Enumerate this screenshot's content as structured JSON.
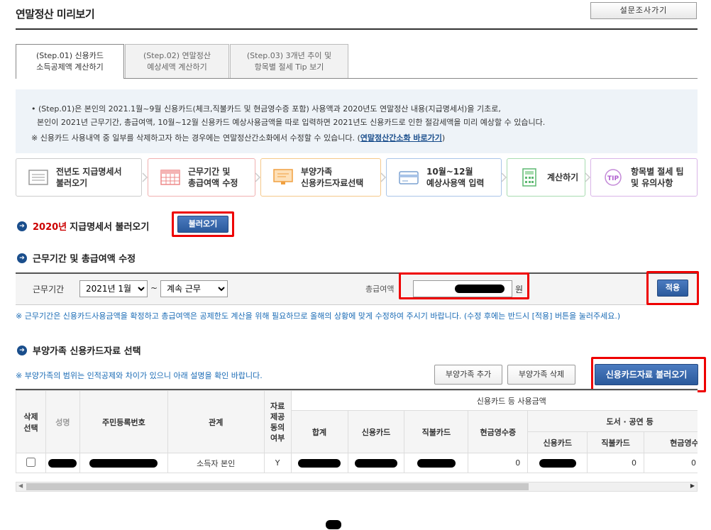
{
  "page": {
    "title": "연말정산 미리보기",
    "survey_button": "설문조사가기"
  },
  "tabs": [
    {
      "line1": "(Step.01) 신용카드",
      "line2": "소득공제액 계산하기",
      "active": true
    },
    {
      "line1": "(Step.02) 연말정산",
      "line2": "예상세액 계산하기",
      "active": false
    },
    {
      "line1": "(Step.03) 3개년 추이 및",
      "line2": "항목별 절세 Tip 보기",
      "active": false
    }
  ],
  "notice": {
    "line1": "• (Step.01)은 본인의 2021.1월~9월 신용카드(체크,직불카드 및 현금영수증 포함) 사용액과 2020년도 연말정산 내용(지급명세서)을 기초로,",
    "line2": "본인이 2021년 근무기간, 총급여액, 10월~12월 신용카드 예상사용금액을 따로 입력하면 2021년도 신용카드로 인한 절감세액을 미리 예상할 수 있습니다.",
    "line3_prefix": "※ 신용카드 사용내역 중 일부를 삭제하고자 하는 경우에는 연말정산간소화에서 수정할 수 있습니다. (",
    "line3_link": "연말정산간소화 바로가기",
    "line3_suffix": ")"
  },
  "steps": [
    {
      "line1": "전년도 지급명세서",
      "line2": "불러오기",
      "icon": "document-icon",
      "border": "#cccccc"
    },
    {
      "line1": "근무기간 및",
      "line2": "총급여액 수정",
      "icon": "calendar-icon",
      "border": "#f0b0b0"
    },
    {
      "line1": "부양가족",
      "line2": "신용카드자료선택",
      "icon": "monitor-icon",
      "border": "#f5c88a"
    },
    {
      "line1": "10월~12월",
      "line2": "예상사용액 입력",
      "icon": "card-icon",
      "border": "#a9c4e8"
    },
    {
      "line1": "계산하기",
      "line2": "",
      "icon": "calculator-icon",
      "border": "#a8dcb0"
    },
    {
      "line1": "항목별 절세 팁",
      "line2": "및 유의사항",
      "icon": "tip-icon",
      "border": "#d9b5e8"
    }
  ],
  "section1": {
    "year": "2020년",
    "title": "지급명세서 불러오기",
    "button": "불러오기"
  },
  "section2": {
    "title": "근무기간 및 총급여액 수정",
    "period_label": "근무기간",
    "start_value": "2021년 1월",
    "separator": "~",
    "end_value": "계속 근무",
    "salary_label": "총급여액",
    "currency": "원",
    "apply_button": "적용",
    "note": "※ 근무기간은 신용카드사용금액을 확정하고 총급여액은 공제한도 계산을 위해 필요하므로 올해의 상황에 맞게 수정하여 주시기 바랍니다. (수정 후에는 반드시 [적용] 버튼을 눌러주세요.)"
  },
  "section3": {
    "title": "부양가족 신용카드자료 선택",
    "note": "※ 부양가족의 범위는 인적공제와 차이가 있으니 아래 설명을 확인 바랍니다.",
    "add_button": "부양가족 추가",
    "delete_button": "부양가족 삭제",
    "load_button": "신용카드자료 불러오기"
  },
  "table": {
    "h_delete": "삭제\n선택",
    "h_name": "성명",
    "h_id": "주민등록번호",
    "h_relation": "관계",
    "h_consent": "자료\n제공\n동의\n여부",
    "h_group": "신용카드 등 사용금액",
    "h_total": "합계",
    "h_credit": "신용카드",
    "h_debit": "직불카드",
    "h_cash": "현금영수증",
    "h_culture": "도서 · 공연 등",
    "h_c_credit": "신용카드",
    "h_c_debit": "직불카드",
    "h_c_cash": "현금영수증",
    "rows": [
      {
        "relation": "소득자 본인",
        "consent": "Y",
        "cash": "0",
        "c_debit": "0",
        "c_cash": "0"
      }
    ]
  }
}
